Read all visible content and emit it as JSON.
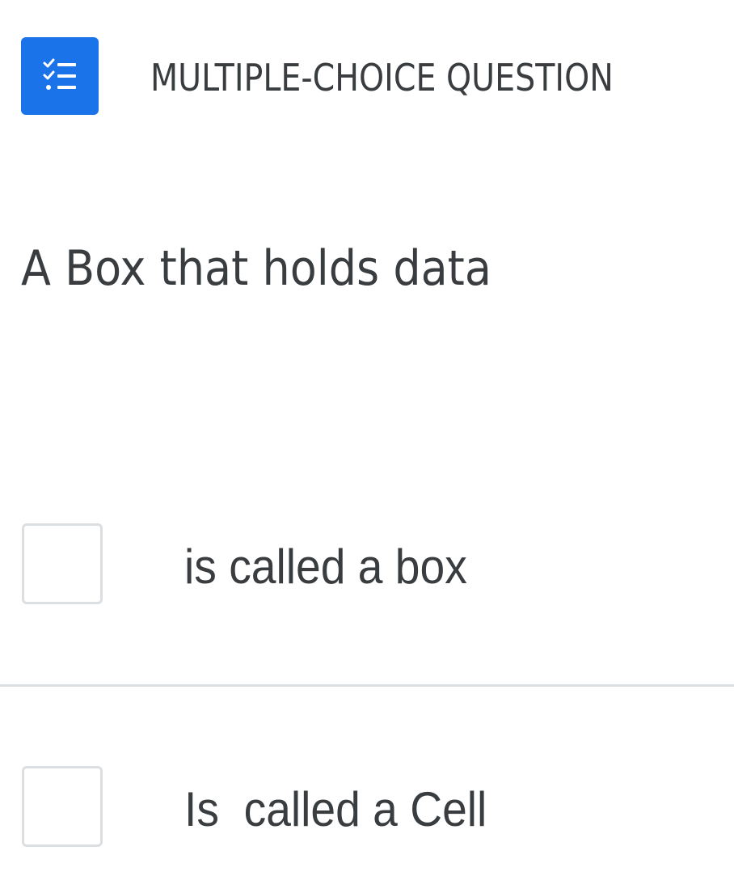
{
  "header": {
    "icon": "checklist-icon",
    "question_type": "MULTIPLE-CHOICE QUESTION",
    "accent_color": "#1a73e8"
  },
  "question": {
    "text": "A Box that holds data"
  },
  "options": [
    {
      "label": "is called a box",
      "checked": false
    },
    {
      "label": "Is  called a Cell",
      "checked": false
    }
  ]
}
